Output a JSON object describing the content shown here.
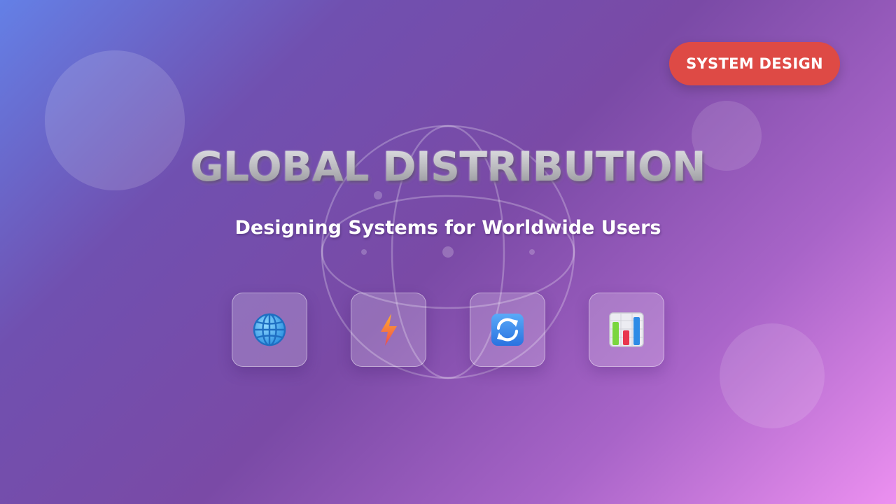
{
  "badge": {
    "label": "SYSTEM DESIGN"
  },
  "title": "GLOBAL DISTRIBUTION",
  "subtitle": "Designing Systems for Worldwide Users",
  "icons": [
    {
      "name": "globe-icon"
    },
    {
      "name": "lightning-icon"
    },
    {
      "name": "sync-icon"
    },
    {
      "name": "bar-chart-icon"
    }
  ],
  "colors": {
    "badge": "#de4a45",
    "gradient_start": "#6480e6",
    "gradient_mid": "#7a4aa6",
    "gradient_end": "#ec90f0"
  }
}
